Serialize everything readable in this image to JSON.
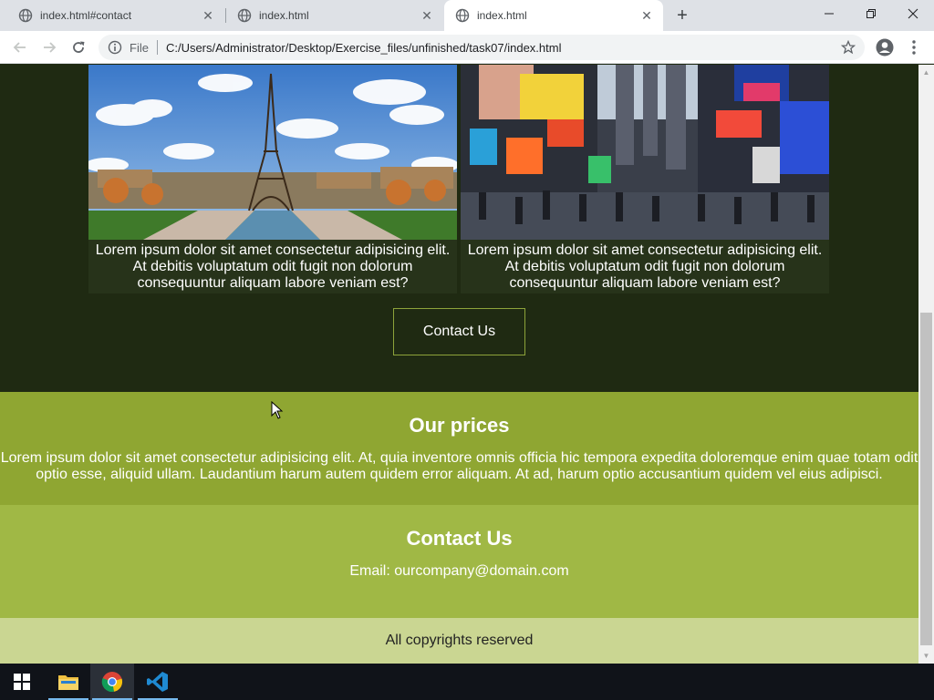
{
  "browser": {
    "tabs": [
      {
        "label": "index.html#contact",
        "active": false
      },
      {
        "label": "index.html",
        "active": false
      },
      {
        "label": "index.html",
        "active": true
      }
    ],
    "address": {
      "scheme_label": "File",
      "url": "C:/Users/Administrator/Desktop/Exercise_files/unfinished/task07/index.html"
    }
  },
  "page": {
    "gallery": {
      "cards": [
        {
          "caption": "Lorem ipsum dolor sit amet consectetur adipisicing elit. At debitis voluptatum odit fugit non dolorum consequuntur aliquam labore veniam est?"
        },
        {
          "caption": "Lorem ipsum dolor sit amet consectetur adipisicing elit. At debitis voluptatum odit fugit non dolorum consequuntur aliquam labore veniam est?"
        }
      ],
      "contact_button": "Contact Us"
    },
    "prices": {
      "title": "Our prices",
      "text": "Lorem ipsum dolor sit amet consectetur adipisicing elit. At, quia inventore omnis officia hic tempora expedita doloremque enim quae totam odit optio esse, aliquid ullam. Laudantium harum autem quidem error aliquam. At ad, harum optio accusantium quidem vel eius adipisci."
    },
    "contact": {
      "title": "Contact Us",
      "email": "Email: ourcompany@domain.com"
    },
    "footer": {
      "text": "All copyrights reserved"
    }
  },
  "colors": {
    "dark_bg": "#1f2a12",
    "prices_bg": "#8fa632",
    "contact_bg": "#a0b845",
    "footer_bg": "#cad692"
  },
  "icons": {
    "tab": "globe-icon",
    "nav": [
      "back-arrow-icon",
      "forward-arrow-icon",
      "reload-icon"
    ],
    "address": [
      "info-icon",
      "star-icon"
    ],
    "toolbar": [
      "profile-icon",
      "menu-dots-icon"
    ],
    "taskbar": [
      "windows-start-icon",
      "file-explorer-icon",
      "chrome-icon",
      "vscode-icon"
    ]
  }
}
